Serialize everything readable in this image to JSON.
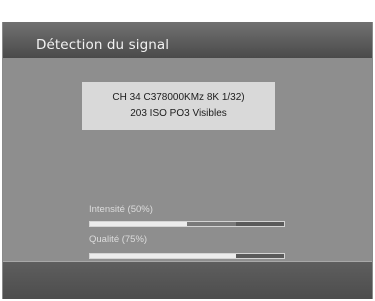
{
  "screen": {
    "title": "Détection du signal"
  },
  "info": {
    "channel_line": "CH 34 C378000KMz 8K 1/32)",
    "programs_line": "203 ISO PO3 Visibles"
  },
  "meters": {
    "intensity": {
      "label": "Intensité (50%)",
      "percent": 50
    },
    "quality": {
      "label": "Qualité (75%)",
      "percent": 75
    }
  },
  "colors": {
    "header": "#5c5c5c",
    "panel": "#8e8e8e",
    "infobox": "#d9d9d9",
    "bar_fill": "#ececec",
    "bar_track": "#3d3d3d"
  }
}
